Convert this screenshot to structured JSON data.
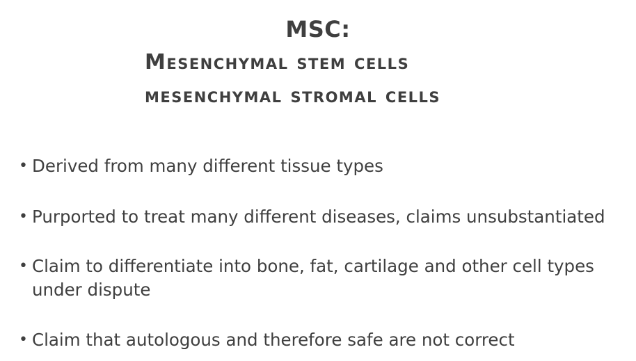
{
  "slide": {
    "title": "MSC:",
    "subtitle_lines": [
      "Mesenchymal stem cells",
      "mesenchymal stromal cells"
    ],
    "bullets": [
      {
        "text": "Derived from many different tissue types"
      },
      {
        "text": "Purported to treat many different diseases, claims unsubstantiated"
      },
      {
        "text": "Claim to differentiate into bone, fat, cartilage and other cell types",
        "text_line2": "under dispute"
      },
      {
        "text": "Claim that autologous and therefore safe are not correct"
      }
    ],
    "bullet_glyph": "•"
  }
}
